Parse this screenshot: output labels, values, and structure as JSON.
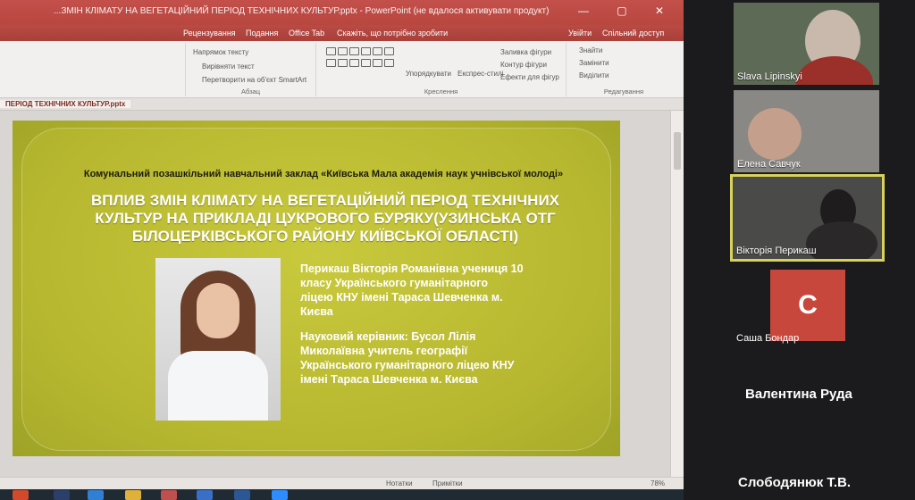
{
  "window": {
    "title": "...ЗМІН КЛІМАТУ НА ВЕГЕТАЦІЙНИЙ ПЕРІОД ТЕХНІЧНИХ КУЛЬТУР.pptx - PowerPoint (не вдалося активувати продукт)",
    "controls": "— ▢ ✕"
  },
  "ribbon_tabs": [
    "Рецензування",
    "Подання",
    "Office Tab",
    "Скажіть, що потрібно зробити",
    "Увійти",
    "Спільний доступ"
  ],
  "ribbon": {
    "paragraph": {
      "label": "Абзац",
      "commands": [
        "Напрямок тексту",
        "Вирівняти текст",
        "Перетворити на об'єкт SmartArt"
      ]
    },
    "drawing": {
      "label": "Креслення",
      "arrange": "Упорядкувати",
      "quick_styles": "Експрес-стилі",
      "shape_fill": "Заливка фігури",
      "shape_outline": "Контур фігури",
      "shape_effects": "Ефекти для фігур"
    },
    "editing": {
      "label": "Редагування",
      "find": "Знайти",
      "replace": "Замінити",
      "select": "Виділити"
    }
  },
  "document_tab": "ПЕРІОД ТЕХНІЧНИХ КУЛЬТУР.pptx",
  "slide": {
    "institution": "Комунальний позашкільний навчальний заклад «Київська Мала академія наук учнівської молоді»",
    "title": "ВПЛИВ ЗМІН КЛІМАТУ НА ВЕГЕТАЦІЙНИЙ ПЕРІОД ТЕХНІЧНИХ КУЛЬТУР НА ПРИКЛАДІ ЦУКРОВОГО БУРЯКУ(УЗИНСЬКА ОТГ БІЛОЦЕРКІВСЬКОГО РАЙОНУ КИЇВСЬКОЇ ОБЛАСТІ)",
    "author": "Перикаш Вікторія Романівна учениця 10 класу Українського гуманітарного ліцею КНУ імені Тараса Шевченка м. Києва",
    "mentor": "Науковий керівник: Бусол Лілія Миколаївна учитель географії Українського гуманітарного ліцею КНУ імені Тараса Шевченка м. Києва"
  },
  "status": {
    "notes": "Нотатки",
    "comments": "Примітки",
    "zoom": "78%"
  },
  "participants": [
    {
      "name": "Slava Lipinskyi"
    },
    {
      "name": "Елена Савчук"
    },
    {
      "name": "Вікторія Перикаш"
    },
    {
      "name": "Саша Бондар",
      "initial": "С"
    }
  ],
  "other_participants": [
    "Валентина Руда",
    "Слободянюк Т.В."
  ],
  "colors": {
    "ppt_accent": "#c0504d",
    "slide_bg": "#b6b72f",
    "avatar_bg": "#c8473c"
  }
}
